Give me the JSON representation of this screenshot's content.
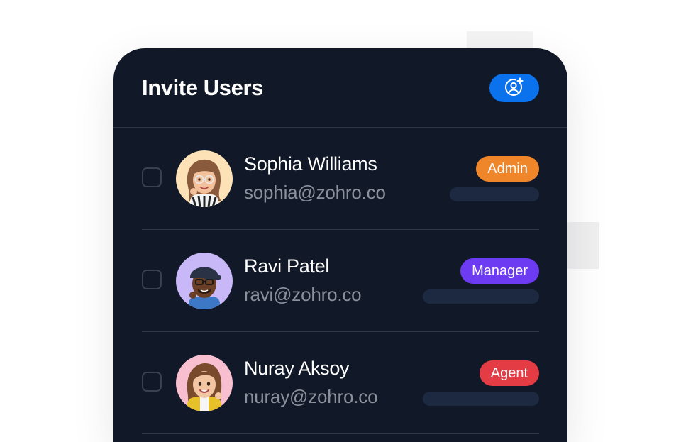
{
  "card": {
    "title": "Invite Users",
    "invite_button_icon": "user-plus-icon"
  },
  "colors": {
    "card_bg": "#111827",
    "accent": "#0b72ee",
    "admin": "#f0862a",
    "manager": "#6d3cf2",
    "agent": "#e43c45"
  },
  "users": [
    {
      "name": "Sophia Williams",
      "email": "sophia@zohro.co",
      "role": "Admin",
      "role_color": "#f0862a",
      "checked": false
    },
    {
      "name": "Ravi Patel",
      "email": "ravi@zohro.co",
      "role": "Manager",
      "role_color": "#6d3cf2",
      "checked": false
    },
    {
      "name": "Nuray Aksoy",
      "email": "nuray@zohro.co",
      "role": "Agent",
      "role_color": "#e43c45",
      "checked": false
    }
  ]
}
